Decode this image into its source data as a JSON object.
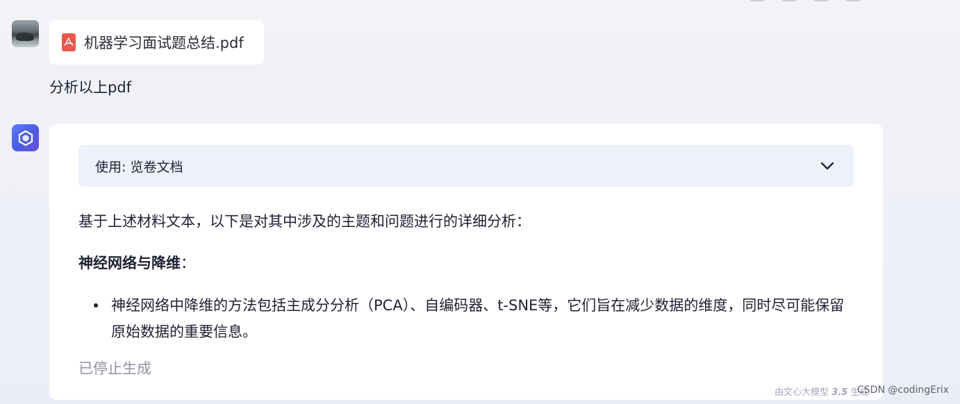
{
  "user_message": {
    "attachment": {
      "file_name": "机器学习面试题总结.pdf",
      "icon": "pdf-icon"
    },
    "text": "分析以上pdf"
  },
  "assistant_message": {
    "tool_usage": {
      "label": "使用: 览卷文档",
      "toggle_icon": "chevron-down-icon"
    },
    "intro": "基于上述材料文本，以下是对其中涉及的主题和问题进行的详细分析：",
    "section": {
      "title": "神经网络与降维",
      "suffix": "：",
      "bullets": [
        "神经网络中降维的方法包括主成分分析（PCA）、自编码器、t-SNE等，它们旨在减少数据的维度，同时尽可能保留原始数据的重要信息。"
      ]
    },
    "status": "已停止生成"
  },
  "footer": {
    "model_prefix": "由文心大模型",
    "model_version": "3.5",
    "model_suffix": "生成",
    "watermark": "CSDN @codingErix"
  },
  "colors": {
    "accent": "#4b5fe3",
    "tool_bar_bg": "#eef0fb",
    "pdf_red": "#e9574f",
    "muted_text": "#8f92a3"
  }
}
